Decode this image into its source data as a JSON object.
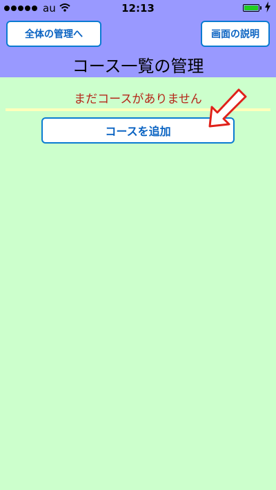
{
  "status_bar": {
    "carrier": "au",
    "time": "12:13",
    "battery_level": 1.0
  },
  "header": {
    "back_button_label": "全体の管理へ",
    "help_button_label": "画面の説明",
    "title": "コース一覧の管理"
  },
  "main": {
    "empty_message": "まだコースがありません",
    "add_course_label": "コースを追加"
  },
  "icons": {
    "wifi": "wifi-icon",
    "battery": "battery-icon",
    "charging": "charging-bolt-icon",
    "pointer": "pointer-arrow-icon"
  },
  "colors": {
    "header_bg": "#9999ff",
    "body_bg": "#ccffcc",
    "button_border": "#0a7bd1",
    "button_text": "#0a63c2",
    "empty_text": "#b52619",
    "divider": "#ffffbb",
    "arrow_fill": "#ffffff",
    "arrow_stroke": "#e0201a"
  }
}
